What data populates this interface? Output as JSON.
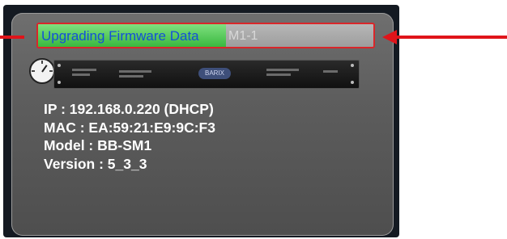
{
  "firmware_update": {
    "status_label": "Upgrading Firmware Data",
    "device_name_ghost": "M1-1",
    "progress_fraction": 0.56
  },
  "device": {
    "logo_label": "BARIX",
    "ip_line": "IP : 192.168.0.220 (DHCP)",
    "mac_line": "MAC : EA:59:21:E9:9C:F3",
    "model_line": "Model : BB-SM1",
    "version_line": "Version : 5_3_3"
  },
  "colors": {
    "progress_border": "#d9262a",
    "progress_fill": "#39b83f",
    "status_text": "#1450d8",
    "annotation_arrow": "#e0141a"
  },
  "icons": {
    "gauge": "gauge-icon",
    "device": "device-unit-image"
  }
}
